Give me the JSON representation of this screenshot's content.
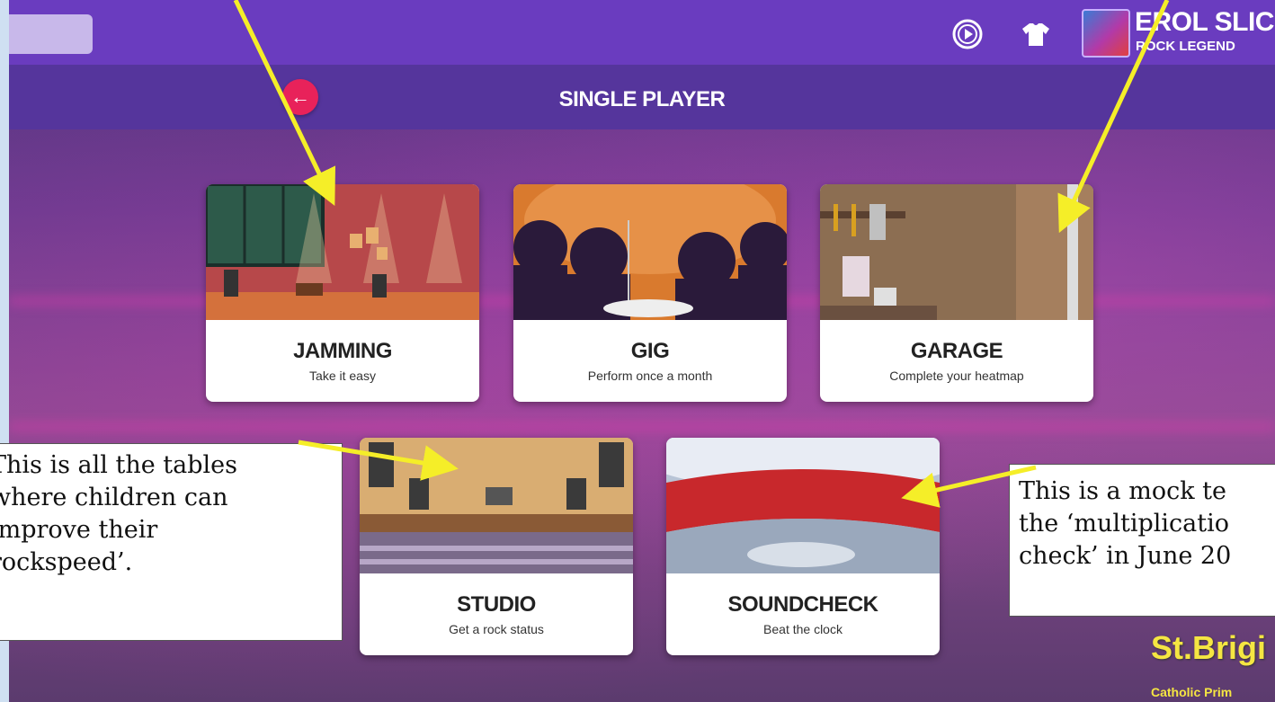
{
  "header": {
    "user_name": "EROL SLICK",
    "user_title": "ROCK LEGEND",
    "play_icon": "play-circle-icon",
    "shirt_icon": "tshirt-icon"
  },
  "page": {
    "title": "SINGLE PLAYER"
  },
  "cards": [
    {
      "title": "JAMMING",
      "subtitle": "Take it easy",
      "image": "jamming-scene"
    },
    {
      "title": "GIG",
      "subtitle": "Perform once a month",
      "image": "gig-scene"
    },
    {
      "title": "GARAGE",
      "subtitle": "Complete your heatmap",
      "image": "garage-scene"
    },
    {
      "title": "STUDIO",
      "subtitle": "Get a rock status",
      "image": "studio-scene"
    },
    {
      "title": "SOUNDCHECK",
      "subtitle": "Beat the clock",
      "image": "soundcheck-scene"
    }
  ],
  "annotations": {
    "left": [
      "This is all the tables",
      "where children can",
      "improve their",
      "rockspeed’."
    ],
    "right": [
      "This is a mock te",
      "the ‘multiplicatio",
      "check’ in June 20"
    ]
  },
  "watermark": {
    "name": "St.Brigi",
    "sub": "Catholic Prim"
  },
  "colors": {
    "topbar": "#6a3cbf",
    "subbar": "#55359c",
    "back_button": "#e8225a",
    "arrow": "#f5ee28"
  }
}
